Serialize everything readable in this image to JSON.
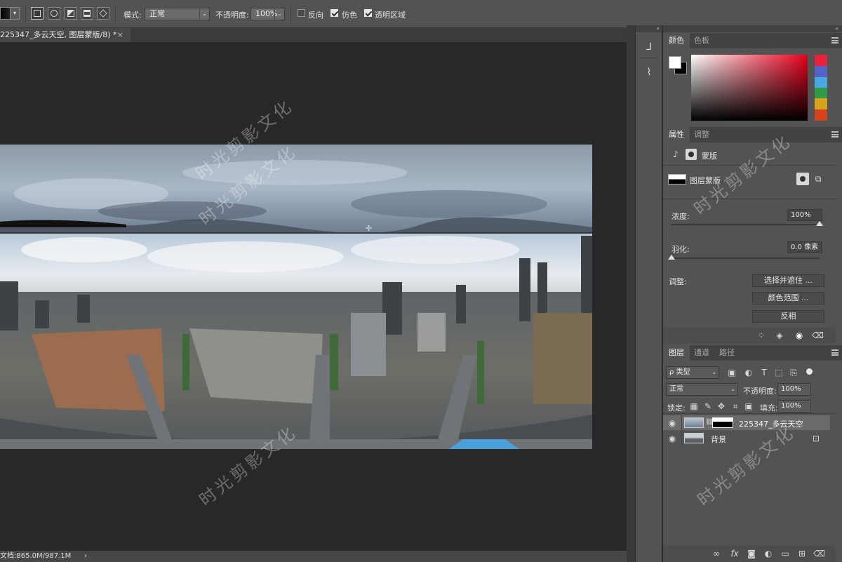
{
  "options_bar": {
    "mode_label": "模式:",
    "mode_value": "正常",
    "opacity_label": "不透明度:",
    "opacity_value": "100%",
    "reverse_label": "反向",
    "dither_label": "仿色",
    "transparency_label": "透明区域",
    "reverse_checked": false,
    "dither_checked": true,
    "transparency_checked": true
  },
  "document": {
    "tab_title": "225347_多云天空, 图层蒙版/8) *",
    "tab_close": "×",
    "status": "文档:865.0M/987.1M",
    "status_arrow": "›"
  },
  "color_panel": {
    "tabs": [
      "颜色",
      "色板"
    ],
    "active_tab": 0,
    "ramp_colors": [
      "#e8223a",
      "#5563c9",
      "#4aa8e0",
      "#2f9a48",
      "#d4a320",
      "#d2431e"
    ]
  },
  "properties_panel": {
    "tabs": [
      "属性",
      "调整"
    ],
    "active_tab": 0,
    "type_label": "蒙版",
    "mask_label": "图层蒙版",
    "density_label": "浓度:",
    "density_value": "100%",
    "density_level": 1.0,
    "feather_label": "羽化:",
    "feather_value": "0.0 像素",
    "feather_level": 0.0,
    "refine_label": "调整:",
    "buttons": [
      "选择并遮住 ...",
      "颜色范围 ...",
      "反相"
    ]
  },
  "layers_panel": {
    "tabs": [
      "图层",
      "通道",
      "路径"
    ],
    "active_tab": 0,
    "filter_kind": "ρ 类型",
    "blend_mode": "正常",
    "opacity_label": "不透明度:",
    "opacity_value": "100%",
    "lock_label": "锁定:",
    "fill_label": "填充:",
    "fill_value": "100%",
    "layers": [
      {
        "name": "225347_多云天空",
        "selected": true,
        "visible": true
      },
      {
        "name": "背景",
        "selected": false,
        "visible": true,
        "locked": true
      }
    ]
  },
  "watermark": "时光剪影文化",
  "accent_colors": {
    "panel": "#535353",
    "panel_dark": "#424242",
    "canvas": "#282828",
    "selection": "#6a6a6a"
  }
}
